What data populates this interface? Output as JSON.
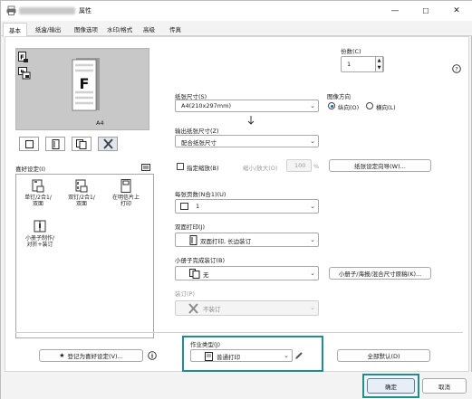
{
  "window": {
    "title": "属性",
    "controls": {
      "minimize": "—",
      "maximize": "☐",
      "close": "✕"
    }
  },
  "tabs": [
    {
      "label": "基本",
      "selected": true
    },
    {
      "label": "纸盒/输出"
    },
    {
      "label": "图像选项"
    },
    {
      "label": "水印/格式"
    },
    {
      "label": "高级"
    },
    {
      "label": "传真"
    }
  ],
  "preview": {
    "paper_label": "A4",
    "page_glyph": "F"
  },
  "favorites": {
    "label": "喜好设定(I)",
    "items": [
      {
        "line1": "单钉/2合1/",
        "line2": "双面"
      },
      {
        "line1": "双钉/2合1/",
        "line2": "双面"
      },
      {
        "line1": "在明信片上",
        "line2": "打印"
      },
      {
        "line1": "小册子制作/",
        "line2": "对折+装订"
      }
    ],
    "register_button": "登记为喜好设定(V)..."
  },
  "copies": {
    "label": "份数(C)",
    "value": "1"
  },
  "paper_size": {
    "label": "纸张尺寸(S)",
    "value": "A4(210x297mm)"
  },
  "orientation": {
    "label": "图像方向",
    "options": [
      {
        "label": "纵向(O)",
        "selected": true
      },
      {
        "label": "横向(L)",
        "selected": false
      }
    ]
  },
  "output_size": {
    "label": "输出纸张尺寸(Z)",
    "value": "配合纸张尺寸"
  },
  "zoom": {
    "checkbox_label": "指定缩放(B)",
    "ratio_label": "缩小/放大(O)",
    "value": "100",
    "unit": "%"
  },
  "paper_wizard_button": "纸张设定向导(W)...",
  "nup": {
    "label": "每张页数(N合1)(U)",
    "value": "1"
  },
  "duplex": {
    "label": "双面打印(J)",
    "value": "双面打印, 长边装订"
  },
  "booklet": {
    "label": "小册子完成装订(B)",
    "value": "无"
  },
  "booklet_button": "小册子/海报/混合尺寸原稿(K)...",
  "staple": {
    "label": "装订(P)",
    "value": "不装订"
  },
  "job_type": {
    "label": "作业类型(J)",
    "value": "普通打印"
  },
  "reset_button": "全部默认(D)",
  "ok_button": "确定",
  "cancel_button": "取消",
  "highlight_color": "#1f8e8e"
}
